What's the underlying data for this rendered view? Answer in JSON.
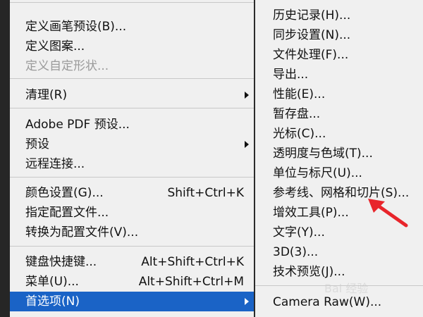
{
  "left_menu": {
    "items": [
      {
        "label": "定义画笔预设(B)..."
      },
      {
        "label": "定义图案..."
      },
      {
        "label": "定义自定形状..."
      },
      {
        "label": "清理(R)"
      },
      {
        "label": "Adobe PDF 预设..."
      },
      {
        "label": "预设"
      },
      {
        "label": "远程连接..."
      },
      {
        "label": "颜色设置(G)...",
        "shortcut": "Shift+Ctrl+K"
      },
      {
        "label": "指定配置文件..."
      },
      {
        "label": "转换为配置文件(V)..."
      },
      {
        "label": "键盘快捷键...",
        "shortcut": "Alt+Shift+Ctrl+K"
      },
      {
        "label": "菜单(U)...",
        "shortcut": "Alt+Shift+Ctrl+M"
      },
      {
        "label": "首选项(N)"
      }
    ]
  },
  "right_menu": {
    "items": [
      {
        "label": "历史记录(H)..."
      },
      {
        "label": "同步设置(N)..."
      },
      {
        "label": "文件处理(F)..."
      },
      {
        "label": "导出..."
      },
      {
        "label": "性能(E)..."
      },
      {
        "label": "暂存盘..."
      },
      {
        "label": "光标(C)..."
      },
      {
        "label": "透明度与色域(T)..."
      },
      {
        "label": "单位与标尺(U)..."
      },
      {
        "label": "参考线、网格和切片(S)..."
      },
      {
        "label": "增效工具(P)..."
      },
      {
        "label": "文字(Y)..."
      },
      {
        "label": "3D(3)..."
      },
      {
        "label": "技术预览(J)..."
      },
      {
        "label": "Camera Raw(W)..."
      }
    ]
  },
  "colors": {
    "menu_bg": "#f0f0f0",
    "highlight": "#1a63c6",
    "annotation_arrow": "#e8252b"
  },
  "watermark": "Bai 经验"
}
